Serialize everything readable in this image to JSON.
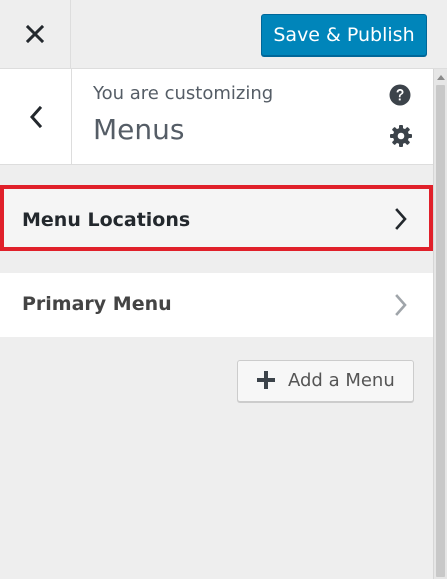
{
  "header": {
    "close_icon": "close-icon",
    "save_label": "Save & Publish",
    "save_color": "#0085ba"
  },
  "info": {
    "back_icon": "chevron-left-icon",
    "customizing_label": "You are customizing",
    "title": "Menus",
    "help_icon": "help-icon",
    "settings_icon": "gear-icon"
  },
  "sections": [
    {
      "label": "Menu Locations",
      "icon": "chevron-right-icon",
      "highlight_color": "#e0202a"
    },
    {
      "label": "Primary Menu",
      "icon": "chevron-right-icon"
    }
  ],
  "add_menu": {
    "icon": "plus-icon",
    "label": "Add a Menu"
  }
}
